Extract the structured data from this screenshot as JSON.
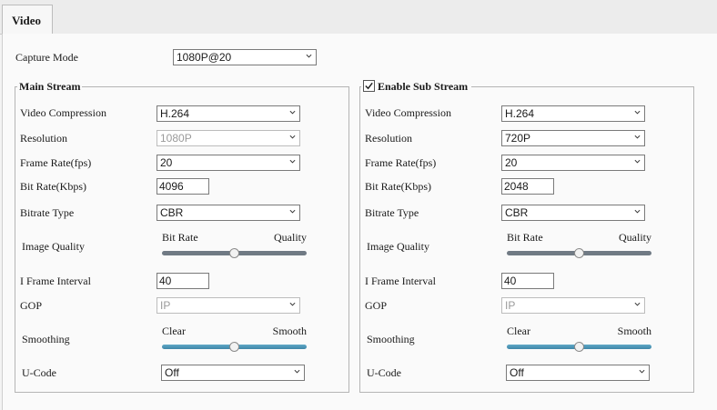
{
  "tab": {
    "label": "Video"
  },
  "capture": {
    "label": "Capture Mode",
    "value": "1080P@20"
  },
  "main": {
    "title": "Main Stream",
    "video_compression": {
      "label": "Video Compression",
      "value": "H.264"
    },
    "resolution": {
      "label": "Resolution",
      "value": "1080P",
      "disabled": true
    },
    "frame_rate": {
      "label": "Frame Rate(fps)",
      "value": "20"
    },
    "bit_rate": {
      "label": "Bit Rate(Kbps)",
      "value": "4096"
    },
    "bitrate_type": {
      "label": "Bitrate Type",
      "value": "CBR"
    },
    "image_quality": {
      "label": "Image Quality",
      "left": "Bit Rate",
      "right": "Quality",
      "level": 0.5
    },
    "i_frame_interval": {
      "label": "I Frame Interval",
      "value": "40"
    },
    "gop": {
      "label": "GOP",
      "value": "IP",
      "disabled": true
    },
    "smoothing": {
      "label": "Smoothing",
      "left": "Clear",
      "right": "Smooth",
      "level": 0.5
    },
    "ucode": {
      "label": "U-Code",
      "value": "Off"
    }
  },
  "sub": {
    "title": "Enable  Sub Stream",
    "enabled": true,
    "video_compression": {
      "label": "Video Compression",
      "value": "H.264"
    },
    "resolution": {
      "label": "Resolution",
      "value": "720P"
    },
    "frame_rate": {
      "label": "Frame Rate(fps)",
      "value": "20"
    },
    "bit_rate": {
      "label": "Bit Rate(Kbps)",
      "value": "2048"
    },
    "bitrate_type": {
      "label": "Bitrate Type",
      "value": "CBR"
    },
    "image_quality": {
      "label": "Image Quality",
      "left": "Bit Rate",
      "right": "Quality",
      "level": 0.5
    },
    "i_frame_interval": {
      "label": "I Frame Interval",
      "value": "40"
    },
    "gop": {
      "label": "GOP",
      "value": "IP",
      "disabled": true
    },
    "smoothing": {
      "label": "Smoothing",
      "left": "Clear",
      "right": "Smooth",
      "level": 0.5
    },
    "ucode": {
      "label": "U-Code",
      "value": "Off"
    }
  }
}
